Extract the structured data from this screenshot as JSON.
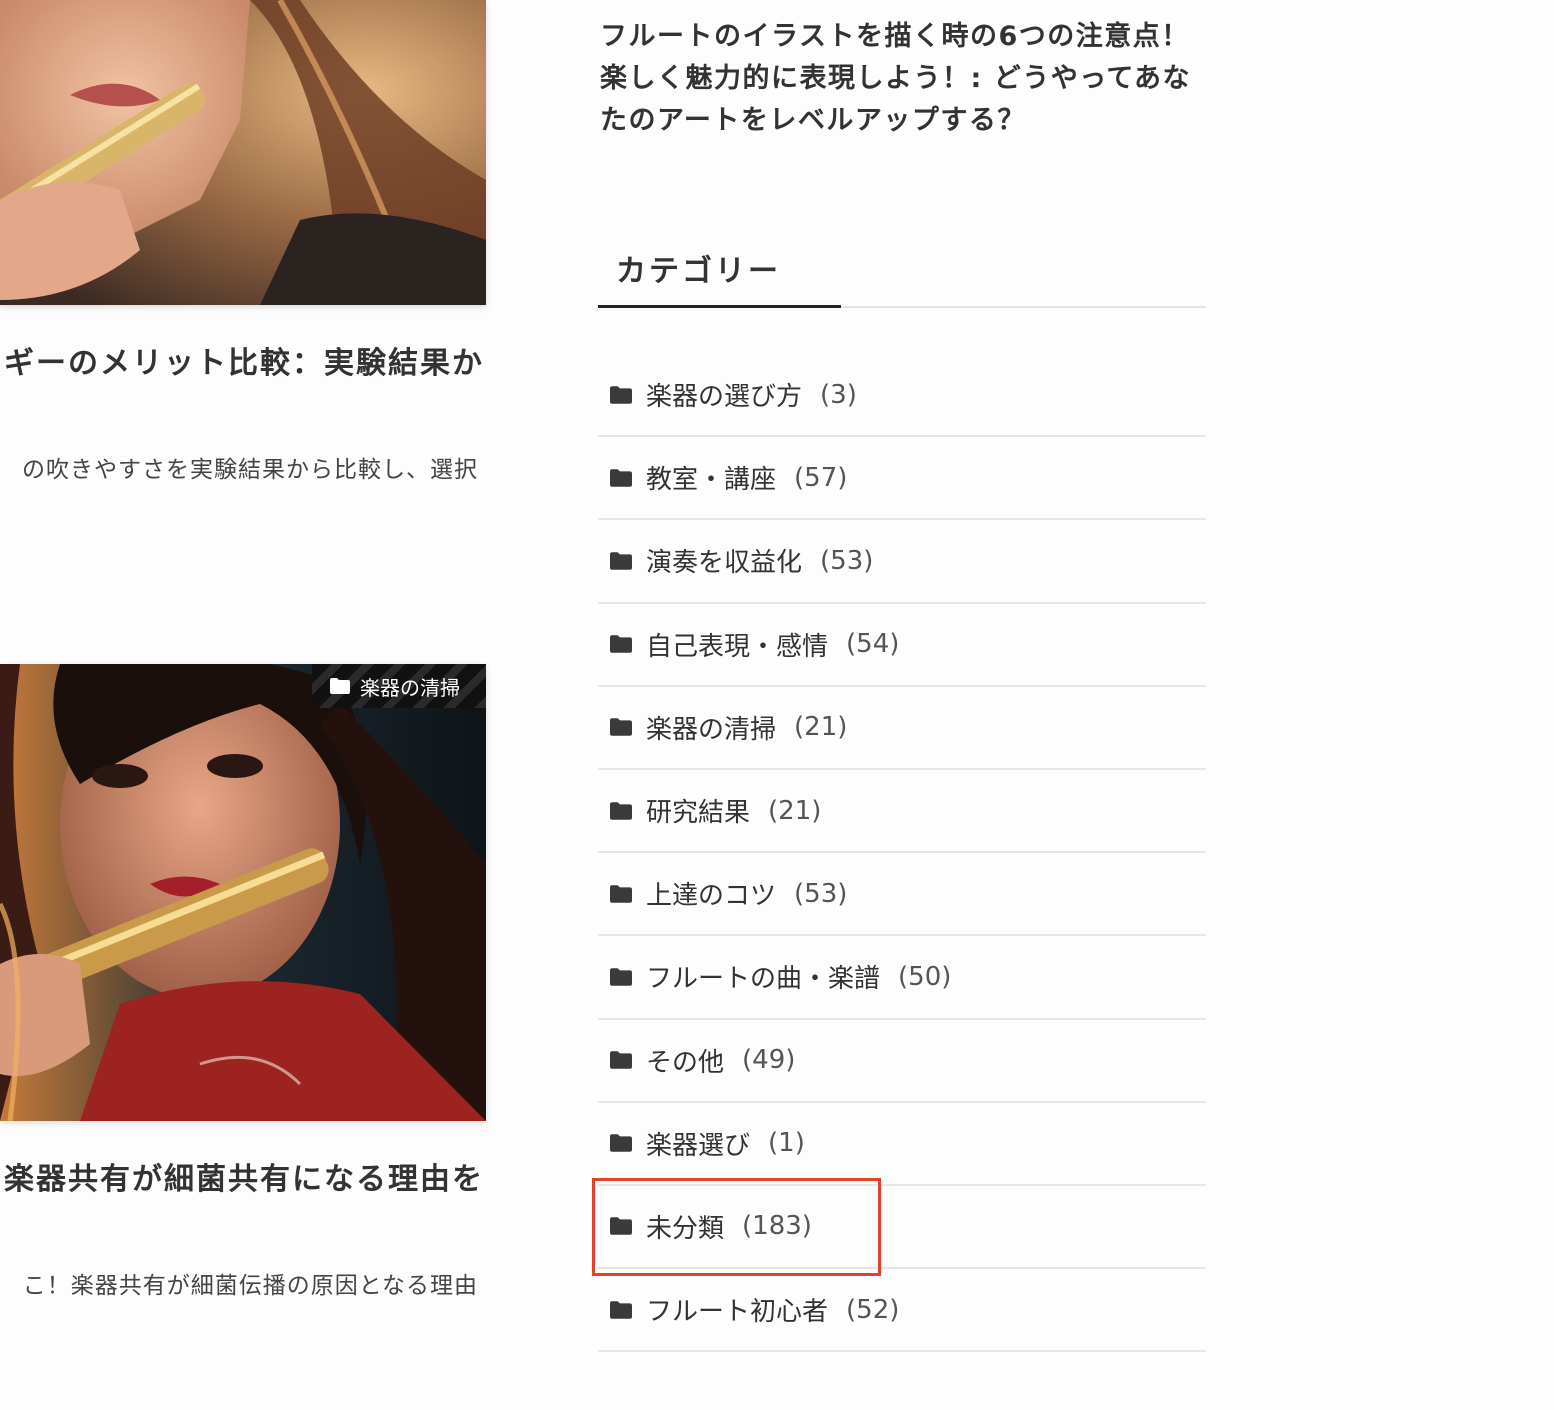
{
  "articles": [
    {
      "title": "ギーのメリット比較：実験結果か",
      "excerpt": "の吹きやすさを実験結果から比較し、選択"
    },
    {
      "category_label": "楽器の清掃",
      "title": "楽器共有が細菌共有になる理由を",
      "excerpt": "こ！楽器共有が細菌伝播の原因となる理由"
    }
  ],
  "sidebar": {
    "recent_post_title": "フルートのイラストを描く時の6つの注意点！楽しく魅力的に表現しよう！: どうやってあなたのアートをレベルアップする？",
    "category_widget": {
      "heading": "カテゴリー",
      "items": [
        {
          "label": "楽器の選び方",
          "count": "(3)"
        },
        {
          "label": "教室・講座",
          "count": "(57)"
        },
        {
          "label": "演奏を収益化",
          "count": "(53)"
        },
        {
          "label": "自己表現・感情",
          "count": "(54)"
        },
        {
          "label": "楽器の清掃",
          "count": "(21)"
        },
        {
          "label": "研究結果",
          "count": "(21)"
        },
        {
          "label": "上達のコツ",
          "count": "(53)"
        },
        {
          "label": "フルートの曲・楽譜",
          "count": "(50)"
        },
        {
          "label": "その他",
          "count": "(49)"
        },
        {
          "label": "楽器選び",
          "count": "(1)"
        },
        {
          "label": "未分類",
          "count": "(183)"
        },
        {
          "label": "フルート初心者",
          "count": "(52)"
        }
      ]
    }
  },
  "colors": {
    "highlight_border": "#e0452b",
    "text": "#333333",
    "divider": "#e6e6e6"
  }
}
